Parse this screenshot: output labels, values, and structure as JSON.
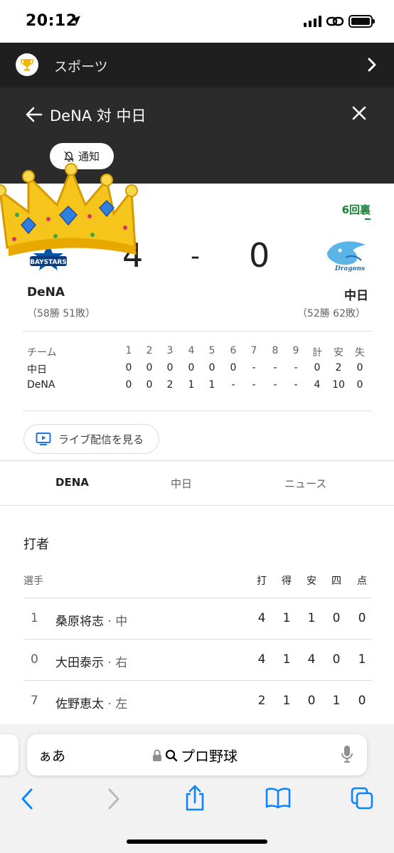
{
  "status": {
    "time": "20:12"
  },
  "header": {
    "section": "スポーツ",
    "title": "DeNA 対 中日",
    "notify_label": "通知"
  },
  "game": {
    "inning": "6回裏",
    "home": {
      "name": "DeNA",
      "record": "（58勝 51敗）",
      "score": "4"
    },
    "away": {
      "name": "中日",
      "record": "（52勝 62敗）",
      "score": "0"
    },
    "separator": "-"
  },
  "linescore": {
    "headers": [
      "チーム",
      "1",
      "2",
      "3",
      "4",
      "5",
      "6",
      "7",
      "8",
      "9",
      "計",
      "安",
      "失"
    ],
    "rows": [
      [
        "中日",
        "0",
        "0",
        "0",
        "0",
        "0",
        "0",
        "-",
        "-",
        "-",
        "0",
        "2",
        "0"
      ],
      [
        "DeNA",
        "0",
        "0",
        "2",
        "1",
        "1",
        "-",
        "-",
        "-",
        "-",
        "4",
        "10",
        "0"
      ]
    ]
  },
  "live_button": "ライブ配信を見る",
  "tabs": [
    {
      "label": "DENA",
      "active": true
    },
    {
      "label": "中日",
      "active": false
    },
    {
      "label": "ニュース",
      "active": false
    }
  ],
  "batting": {
    "title": "打者",
    "headers": [
      "選手",
      "打",
      "得",
      "安",
      "四",
      "点"
    ],
    "rows": [
      {
        "num": "1",
        "name": "桑原将志",
        "pos": " · 中",
        "stats": [
          "4",
          "1",
          "1",
          "0",
          "0"
        ]
      },
      {
        "num": "0",
        "name": "大田泰示",
        "pos": " · 右",
        "stats": [
          "4",
          "1",
          "4",
          "0",
          "1"
        ]
      },
      {
        "num": "7",
        "name": "佐野恵太",
        "pos": " · 左",
        "stats": [
          "2",
          "1",
          "0",
          "1",
          "0"
        ]
      }
    ]
  },
  "safari": {
    "aa": "ぁあ",
    "query": "プロ野球"
  },
  "colors": {
    "header_dark": "#1f1f1f",
    "match_bar": "#2b2b2b",
    "inning_green": "#188038",
    "ios_blue": "#0a84ff"
  }
}
